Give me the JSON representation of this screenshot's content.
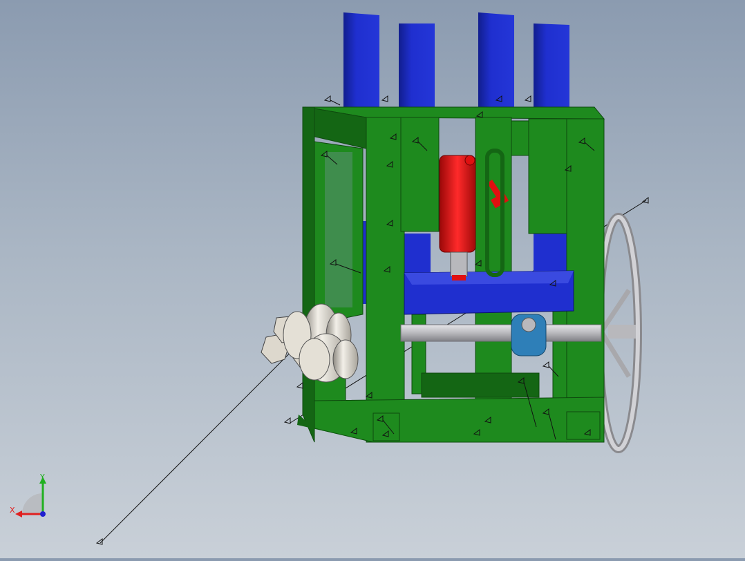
{
  "viewport": {
    "background_top": "#8b9bb0",
    "background_bottom": "#c9d0d8"
  },
  "model": {
    "frame_color": "#1e8a1e",
    "frame_dark": "#146614",
    "post_color": "#1f2fcf",
    "post_dark": "#111e8e",
    "cylinder_color": "#e01010",
    "roller_color": "#d9d4c9",
    "wheel_color": "#c9c9cc",
    "shaft_color": "#b8b8bc",
    "bearing_color": "#2e7fb8",
    "weld_symbol_icon": "weld-symbol-icon"
  },
  "triad": {
    "x_label": "X",
    "y_label": "Y",
    "x_color": "#e02020",
    "y_color": "#20b020",
    "z_color": "#2020d0"
  }
}
